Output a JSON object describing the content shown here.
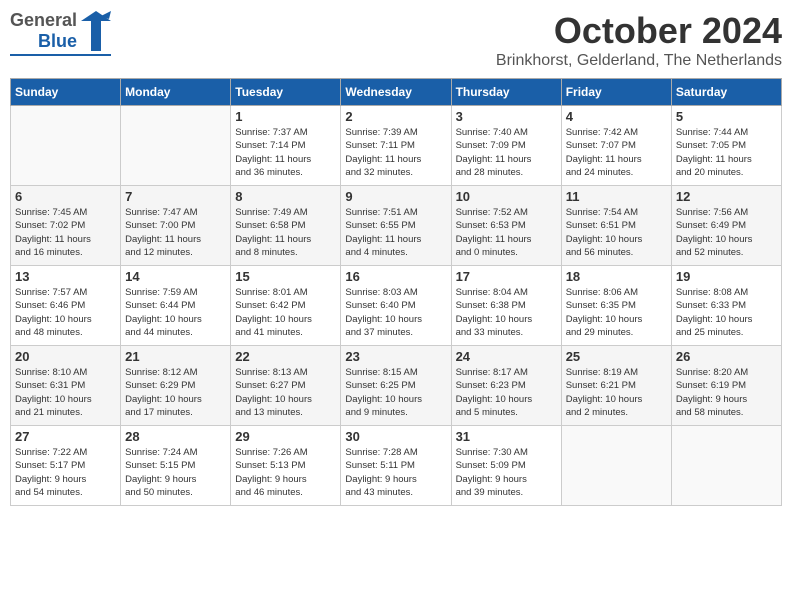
{
  "logo": {
    "general": "General",
    "blue": "Blue"
  },
  "header": {
    "month": "October 2024",
    "location": "Brinkhorst, Gelderland, The Netherlands"
  },
  "weekdays": [
    "Sunday",
    "Monday",
    "Tuesday",
    "Wednesday",
    "Thursday",
    "Friday",
    "Saturday"
  ],
  "weeks": [
    [
      {
        "day": "",
        "info": ""
      },
      {
        "day": "",
        "info": ""
      },
      {
        "day": "1",
        "info": "Sunrise: 7:37 AM\nSunset: 7:14 PM\nDaylight: 11 hours\nand 36 minutes."
      },
      {
        "day": "2",
        "info": "Sunrise: 7:39 AM\nSunset: 7:11 PM\nDaylight: 11 hours\nand 32 minutes."
      },
      {
        "day": "3",
        "info": "Sunrise: 7:40 AM\nSunset: 7:09 PM\nDaylight: 11 hours\nand 28 minutes."
      },
      {
        "day": "4",
        "info": "Sunrise: 7:42 AM\nSunset: 7:07 PM\nDaylight: 11 hours\nand 24 minutes."
      },
      {
        "day": "5",
        "info": "Sunrise: 7:44 AM\nSunset: 7:05 PM\nDaylight: 11 hours\nand 20 minutes."
      }
    ],
    [
      {
        "day": "6",
        "info": "Sunrise: 7:45 AM\nSunset: 7:02 PM\nDaylight: 11 hours\nand 16 minutes."
      },
      {
        "day": "7",
        "info": "Sunrise: 7:47 AM\nSunset: 7:00 PM\nDaylight: 11 hours\nand 12 minutes."
      },
      {
        "day": "8",
        "info": "Sunrise: 7:49 AM\nSunset: 6:58 PM\nDaylight: 11 hours\nand 8 minutes."
      },
      {
        "day": "9",
        "info": "Sunrise: 7:51 AM\nSunset: 6:55 PM\nDaylight: 11 hours\nand 4 minutes."
      },
      {
        "day": "10",
        "info": "Sunrise: 7:52 AM\nSunset: 6:53 PM\nDaylight: 11 hours\nand 0 minutes."
      },
      {
        "day": "11",
        "info": "Sunrise: 7:54 AM\nSunset: 6:51 PM\nDaylight: 10 hours\nand 56 minutes."
      },
      {
        "day": "12",
        "info": "Sunrise: 7:56 AM\nSunset: 6:49 PM\nDaylight: 10 hours\nand 52 minutes."
      }
    ],
    [
      {
        "day": "13",
        "info": "Sunrise: 7:57 AM\nSunset: 6:46 PM\nDaylight: 10 hours\nand 48 minutes."
      },
      {
        "day": "14",
        "info": "Sunrise: 7:59 AM\nSunset: 6:44 PM\nDaylight: 10 hours\nand 44 minutes."
      },
      {
        "day": "15",
        "info": "Sunrise: 8:01 AM\nSunset: 6:42 PM\nDaylight: 10 hours\nand 41 minutes."
      },
      {
        "day": "16",
        "info": "Sunrise: 8:03 AM\nSunset: 6:40 PM\nDaylight: 10 hours\nand 37 minutes."
      },
      {
        "day": "17",
        "info": "Sunrise: 8:04 AM\nSunset: 6:38 PM\nDaylight: 10 hours\nand 33 minutes."
      },
      {
        "day": "18",
        "info": "Sunrise: 8:06 AM\nSunset: 6:35 PM\nDaylight: 10 hours\nand 29 minutes."
      },
      {
        "day": "19",
        "info": "Sunrise: 8:08 AM\nSunset: 6:33 PM\nDaylight: 10 hours\nand 25 minutes."
      }
    ],
    [
      {
        "day": "20",
        "info": "Sunrise: 8:10 AM\nSunset: 6:31 PM\nDaylight: 10 hours\nand 21 minutes."
      },
      {
        "day": "21",
        "info": "Sunrise: 8:12 AM\nSunset: 6:29 PM\nDaylight: 10 hours\nand 17 minutes."
      },
      {
        "day": "22",
        "info": "Sunrise: 8:13 AM\nSunset: 6:27 PM\nDaylight: 10 hours\nand 13 minutes."
      },
      {
        "day": "23",
        "info": "Sunrise: 8:15 AM\nSunset: 6:25 PM\nDaylight: 10 hours\nand 9 minutes."
      },
      {
        "day": "24",
        "info": "Sunrise: 8:17 AM\nSunset: 6:23 PM\nDaylight: 10 hours\nand 5 minutes."
      },
      {
        "day": "25",
        "info": "Sunrise: 8:19 AM\nSunset: 6:21 PM\nDaylight: 10 hours\nand 2 minutes."
      },
      {
        "day": "26",
        "info": "Sunrise: 8:20 AM\nSunset: 6:19 PM\nDaylight: 9 hours\nand 58 minutes."
      }
    ],
    [
      {
        "day": "27",
        "info": "Sunrise: 7:22 AM\nSunset: 5:17 PM\nDaylight: 9 hours\nand 54 minutes."
      },
      {
        "day": "28",
        "info": "Sunrise: 7:24 AM\nSunset: 5:15 PM\nDaylight: 9 hours\nand 50 minutes."
      },
      {
        "day": "29",
        "info": "Sunrise: 7:26 AM\nSunset: 5:13 PM\nDaylight: 9 hours\nand 46 minutes."
      },
      {
        "day": "30",
        "info": "Sunrise: 7:28 AM\nSunset: 5:11 PM\nDaylight: 9 hours\nand 43 minutes."
      },
      {
        "day": "31",
        "info": "Sunrise: 7:30 AM\nSunset: 5:09 PM\nDaylight: 9 hours\nand 39 minutes."
      },
      {
        "day": "",
        "info": ""
      },
      {
        "day": "",
        "info": ""
      }
    ]
  ]
}
